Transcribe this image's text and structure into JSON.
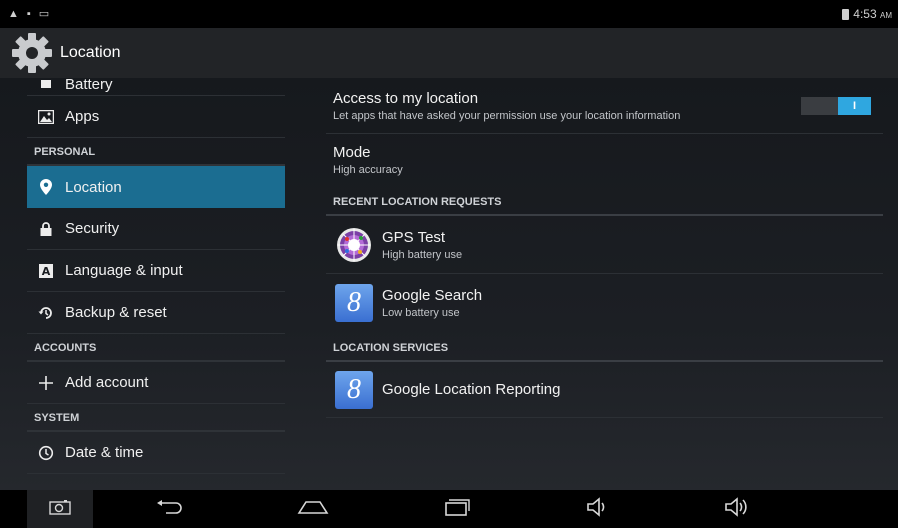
{
  "status_bar": {
    "left_icons": [
      "warning-icon",
      "lock-icon",
      "screenshot-icon"
    ],
    "time": "4:53",
    "ampm": "AM"
  },
  "action_bar": {
    "title": "Location"
  },
  "sidebar": {
    "items_top": [
      {
        "label": "Battery",
        "icon": "battery-icon"
      },
      {
        "label": "Apps",
        "icon": "apps-icon"
      }
    ],
    "personal_header": "PERSONAL",
    "personal_items": [
      {
        "label": "Location",
        "icon": "location-pin-icon",
        "selected": true
      },
      {
        "label": "Security",
        "icon": "lock-icon"
      },
      {
        "label": "Language & input",
        "icon": "keyboard-a-icon"
      },
      {
        "label": "Backup & reset",
        "icon": "backup-icon"
      }
    ],
    "accounts_header": "ACCOUNTS",
    "accounts_items": [
      {
        "label": "Add account",
        "icon": "plus-icon"
      }
    ],
    "system_header": "SYSTEM",
    "system_items": [
      {
        "label": "Date & time",
        "icon": "clock-icon"
      }
    ]
  },
  "detail": {
    "access": {
      "title": "Access to my location",
      "subtitle": "Let apps that have asked your permission use your location information",
      "toggle_label": "I",
      "toggle_on": true
    },
    "mode": {
      "title": "Mode",
      "value": "High accuracy"
    },
    "recent_header": "RECENT LOCATION REQUESTS",
    "recent_requests": [
      {
        "name": "GPS Test",
        "usage": "High battery use",
        "icon": "gps-test-icon"
      },
      {
        "name": "Google Search",
        "usage": "Low battery use",
        "icon": "google-search-icon"
      }
    ],
    "services_header": "LOCATION SERVICES",
    "services": [
      {
        "name": "Google Location Reporting",
        "icon": "google-location-icon",
        "glyph": "8"
      }
    ],
    "google_glyph": "8"
  },
  "colors": {
    "accent": "#2fa7e0",
    "selected_bg": "#1b6d91"
  }
}
